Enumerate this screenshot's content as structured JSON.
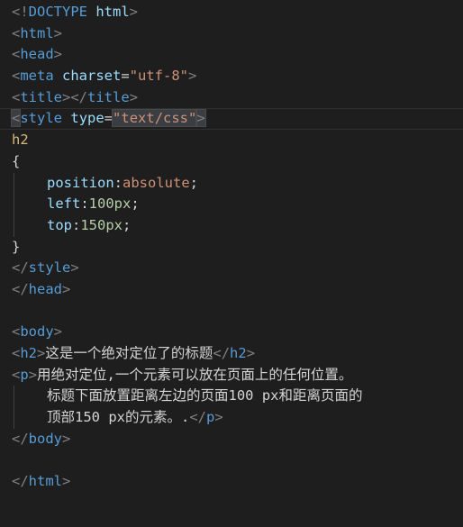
{
  "lines": {
    "l1": {
      "open": "<!",
      "doctype": "DOCTYPE",
      "name": "html",
      "close": ">"
    },
    "l2": {
      "open": "<",
      "tag": "html",
      "close": ">"
    },
    "l3": {
      "open": "<",
      "tag": "head",
      "close": ">"
    },
    "l4": {
      "open": "<",
      "tag": "meta",
      "attr": "charset",
      "eq": "=",
      "value": "\"utf-8\"",
      "close": ">"
    },
    "l5": {
      "open": "<",
      "tag": "title",
      "mid": "></",
      "tag2": "title",
      "close": ">"
    },
    "l6": {
      "open": "<",
      "tag": "style",
      "attr": "type",
      "eq": "=",
      "value": "\"text/css\"",
      "close": ">"
    },
    "l7": {
      "selector": "h2"
    },
    "l8": {
      "brace": "{"
    },
    "l9": {
      "prop": "position",
      "colon": ":",
      "value": "absolute",
      "semi": ";"
    },
    "l10": {
      "prop": "left",
      "colon": ":",
      "value": "100px",
      "semi": ";"
    },
    "l11": {
      "prop": "top",
      "colon": ":",
      "value": "150px",
      "semi": ";"
    },
    "l12": {
      "brace": "}"
    },
    "l13": {
      "open": "</",
      "tag": "style",
      "close": ">"
    },
    "l14": {
      "open": "</",
      "tag": "head",
      "close": ">"
    },
    "l16": {
      "open": "<",
      "tag": "body",
      "close": ">"
    },
    "l17": {
      "open": "<",
      "tag": "h2",
      "close": ">",
      "text": "这是一个绝对定位了的标题",
      "open2": "</",
      "tag2": "h2",
      "close2": ">"
    },
    "l18": {
      "open": "<",
      "tag": "p",
      "close": ">",
      "text": "用绝对定位,一个元素可以放在页面上的任何位置。"
    },
    "l19": {
      "text": "标题下面放置距离左边的页面100 px和距离页面的"
    },
    "l20": {
      "text": "顶部150 px的元素。.",
      "open2": "</",
      "tag2": "p",
      "close2": ">"
    },
    "l21": {
      "open": "</",
      "tag": "body",
      "close": ">"
    },
    "l23": {
      "open": "</",
      "tag": "html",
      "close": ">"
    }
  }
}
